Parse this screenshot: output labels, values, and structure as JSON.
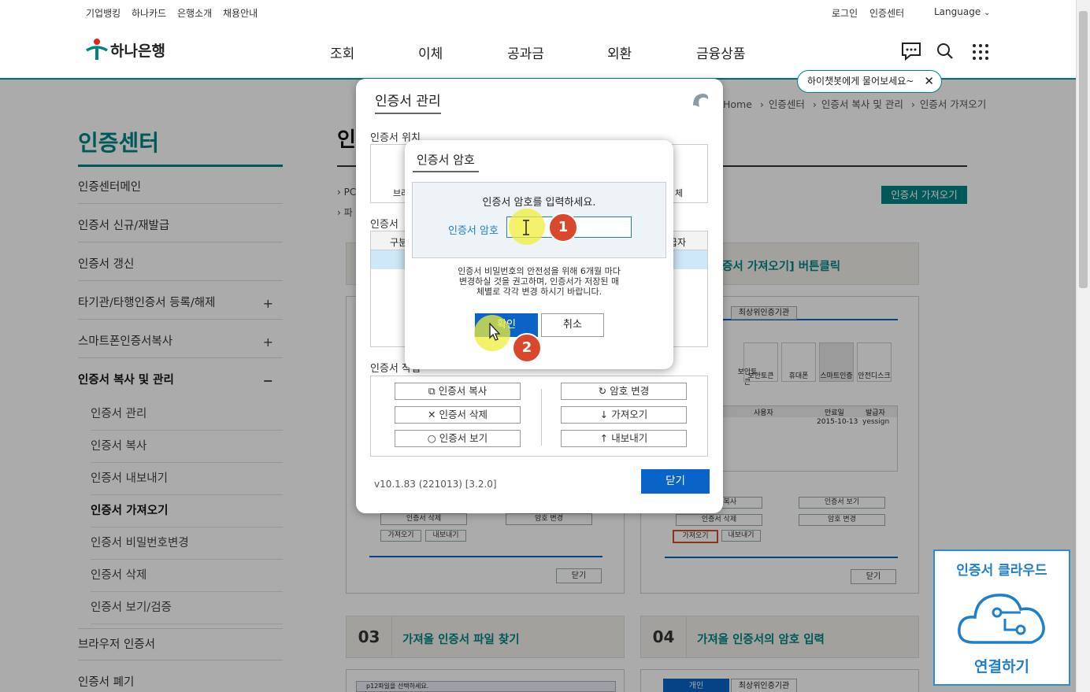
{
  "topbar": {
    "left_links": [
      "기업뱅킹",
      "하나카드",
      "은행소개",
      "채용안내"
    ],
    "login": "로그인",
    "cert_center": "인증센터",
    "language": "Language"
  },
  "header": {
    "logo_text": "하나은행",
    "nav": [
      "조회",
      "이체",
      "공과금",
      "외환",
      "금융상품"
    ],
    "chatbot_tooltip": "하이챗봇에게 물어보세요~"
  },
  "breadcrumb": [
    "Home",
    "인증센터",
    "인증서 복사 및 관리",
    "인증서 가져오기"
  ],
  "sidebar": {
    "title": "인증센터",
    "items": [
      {
        "label": "인증센터메인"
      },
      {
        "label": "인증서 신규/재발급"
      },
      {
        "label": "인증서 갱신"
      },
      {
        "label": "타기관/타행인증서 등록/해제",
        "toggle": "+"
      },
      {
        "label": "스마트폰인증서복사",
        "toggle": "+"
      },
      {
        "label": "인증서 복사 및 관리",
        "toggle": "−"
      }
    ],
    "sub_items": [
      "인증서 관리",
      "인증서 복사",
      "인증서 내보내기",
      "인증서 가져오기",
      "인증서 비밀번호변경",
      "인증서 삭제",
      "인증서 보기/검증"
    ],
    "more_items": [
      "브라우저 인증서",
      "인증서 폐기"
    ]
  },
  "content": {
    "page_title_partial": "인증",
    "bullet_1": "PC",
    "bullet_2": "파",
    "import_button": "인증서 가져오기",
    "step2_text": "[인증서 가져오기] 버튼클릭",
    "step2_text_visible": "증서 가져오기] 버튼클릭",
    "step3_num": "03",
    "step3_text": "가져올 인증서 파일 찾기",
    "step4_num": "04",
    "step4_text": "가져올 인증서의 암호 입력",
    "thumb_tabs": [
      "개인",
      "최상위인증기관"
    ],
    "thumb_devices": [
      "보안토큰",
      "휴대폰",
      "스마트인증",
      "안전디스크"
    ],
    "thumb_cols": [
      "사용자",
      "만료일",
      "발급자"
    ],
    "thumb_row": {
      "expire": "2015-10-13",
      "issuer": "yessign"
    },
    "thumb_btns_left": [
      "인증서 삭제",
      "암호 변경",
      "가져오기",
      "내보내기"
    ],
    "thumb_btns_right": [
      "인증서 복사",
      "인증서 보기",
      "인증서 삭제",
      "암호 변경",
      "가져오기",
      "내보내기"
    ],
    "thumb_close": "닫기",
    "thumb_file_caption": "p12파일을 선택하세요."
  },
  "cloud_banner": {
    "title": "인증서 클라우드",
    "action": "연결하기"
  },
  "cert_manager": {
    "title": "인증서 관리",
    "location_label": "인증서 위치",
    "location_left": "브라",
    "location_right": "체",
    "list_label": "인증서",
    "col_left": "구분",
    "col_right": "급자",
    "ops_label": "인증서 작업",
    "ops_left": [
      "인증서 복사",
      "인증서 삭제",
      "인증서 보기"
    ],
    "ops_right": [
      "암호 변경",
      "가져오기",
      "내보내기"
    ],
    "version": "v10.1.83 (221013) [3.2.0]",
    "close": "닫기"
  },
  "password_dialog": {
    "title": "인증서 암호",
    "prompt": "인증서 암호를 입력하세요.",
    "field_label": "인증서 암호",
    "field_value": "",
    "notice_line1": "인증서 비밀번호의 안전성을 위해 6개월 마다",
    "notice_line2": "변경하실 것을 권고하며, 인증서가 저장된 매",
    "notice_line3": "체별로 각각 변경 하시기 바랍니다.",
    "ok": "확인",
    "cancel": "취소"
  },
  "markers": [
    "1",
    "2"
  ],
  "colors": {
    "brand": "#008485",
    "primary_button": "#0a64c8",
    "marker": "#d9482b",
    "highlight": "#f0ee3a"
  }
}
